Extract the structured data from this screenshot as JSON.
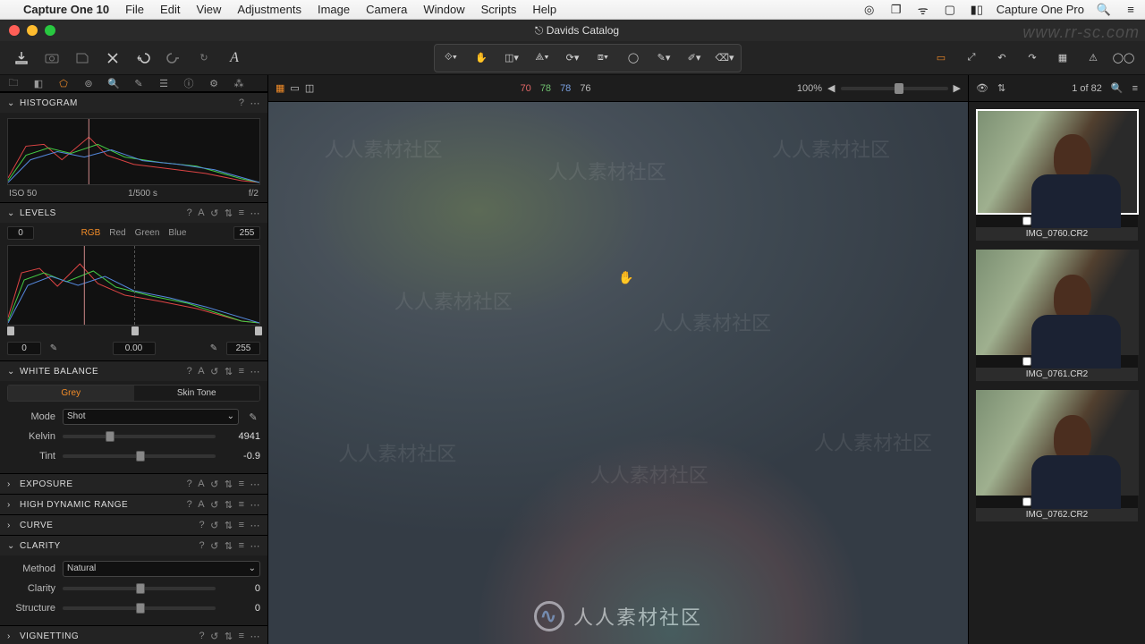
{
  "menubar": {
    "app": "Capture One 10",
    "items": [
      "File",
      "Edit",
      "View",
      "Adjustments",
      "Image",
      "Camera",
      "Window",
      "Scripts",
      "Help"
    ],
    "right_app": "Capture One Pro"
  },
  "window": {
    "title": "Davids Catalog"
  },
  "watermark_url": "www.rr-sc.com",
  "center_watermark": "人人素材社区",
  "viewer": {
    "readout": {
      "r": "70",
      "g": "78",
      "b": "78",
      "l": "76"
    },
    "zoom": "100%",
    "counter": "1 of 82"
  },
  "histogram": {
    "title": "HISTOGRAM",
    "iso": "ISO 50",
    "shutter": "1/500 s",
    "aperture": "f/2"
  },
  "levels": {
    "title": "LEVELS",
    "low": "0",
    "high": "255",
    "channels": [
      "RGB",
      "Red",
      "Green",
      "Blue"
    ],
    "out_low": "0",
    "gamma": "0.00",
    "out_high": "255"
  },
  "wb": {
    "title": "WHITE BALANCE",
    "tabs": [
      "Grey",
      "Skin Tone"
    ],
    "mode_label": "Mode",
    "mode_value": "Shot",
    "kelvin_label": "Kelvin",
    "kelvin_value": "4941",
    "tint_label": "Tint",
    "tint_value": "-0.9"
  },
  "exposure": {
    "title": "EXPOSURE"
  },
  "hdr": {
    "title": "HIGH DYNAMIC RANGE"
  },
  "curve": {
    "title": "CURVE"
  },
  "clarity": {
    "title": "CLARITY",
    "method_label": "Method",
    "method_value": "Natural",
    "clarity_label": "Clarity",
    "clarity_value": "0",
    "structure_label": "Structure",
    "structure_value": "0"
  },
  "vignetting": {
    "title": "VIGNETTING"
  },
  "thumbs": [
    {
      "name": "IMG_0760.CR2",
      "selected": true
    },
    {
      "name": "IMG_0761.CR2",
      "selected": false
    },
    {
      "name": "IMG_0762.CR2",
      "selected": false
    }
  ],
  "icons": {
    "question": "?",
    "dots": "⋯",
    "chev_down": "⌄",
    "chev_right": "›",
    "eyedrop": "✎"
  }
}
